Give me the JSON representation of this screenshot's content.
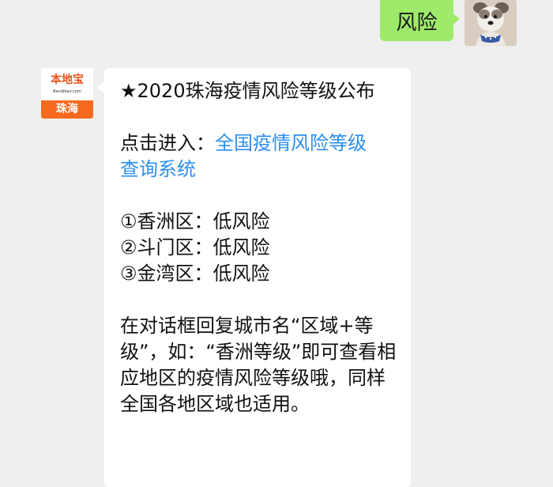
{
  "conversation": {
    "user_message": {
      "text": "风险"
    },
    "bot_message": {
      "avatar": {
        "brand": "本地宝",
        "url": "Bendibao.com",
        "city": "珠海"
      },
      "title": "★2020珠海疫情风险等级公布",
      "entry_prefix": "点击进入：",
      "entry_link_line1": "全国疫情风险等级",
      "entry_link_line2": "查询系统",
      "districts": [
        {
          "label": "①香洲区：低风险"
        },
        {
          "label": "②斗门区：低风险"
        },
        {
          "label": "③金湾区：低风险"
        }
      ],
      "instruction": "在对话框回复城市名“区域+等级”，如：“香洲等级”即可查看相应地区的疫情风险等级哦，同样全国各地区域也适用。"
    }
  },
  "colors": {
    "background": "#efefef",
    "user_bubble": "#9eea6a",
    "bot_bubble": "#ffffff",
    "link": "#2c8ff0",
    "brand_orange": "#f56a1f"
  }
}
